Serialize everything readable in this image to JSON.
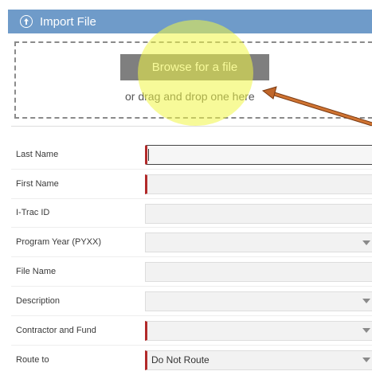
{
  "header": {
    "title": "Import File",
    "icon": "upload-circle-icon"
  },
  "upload": {
    "browse_label": "Browse for a file",
    "drop_hint": "or drag and drop one here"
  },
  "form": {
    "fields": [
      {
        "label": "Last Name",
        "type": "text",
        "required": true,
        "focused": true,
        "value": ""
      },
      {
        "label": "First Name",
        "type": "text",
        "required": true,
        "value": ""
      },
      {
        "label": "I-Trac ID",
        "type": "text",
        "required": false,
        "value": ""
      },
      {
        "label": "Program Year (PYXX)",
        "type": "select",
        "required": false,
        "value": ""
      },
      {
        "label": "File Name",
        "type": "text",
        "required": false,
        "value": ""
      },
      {
        "label": "Description",
        "type": "select",
        "required": false,
        "value": ""
      },
      {
        "label": "Contractor and Fund",
        "type": "select",
        "required": true,
        "value": ""
      },
      {
        "label": "Route to",
        "type": "select",
        "required": true,
        "value": "Do Not Route"
      }
    ]
  },
  "colors": {
    "header_bg": "#6f9bc9",
    "required_marker": "#b22a2a",
    "highlight": "#f0f546",
    "arrow": "#c0662a"
  }
}
